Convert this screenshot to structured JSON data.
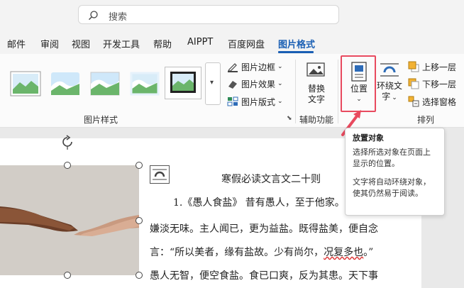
{
  "search": {
    "placeholder": "搜索"
  },
  "tabs": [
    {
      "label": "邮件"
    },
    {
      "label": "审阅"
    },
    {
      "label": "视图"
    },
    {
      "label": "开发工具"
    },
    {
      "label": "帮助"
    },
    {
      "label": "AIPPT"
    },
    {
      "label": "百度网盘"
    },
    {
      "label": "图片格式"
    }
  ],
  "ribbon": {
    "picture_styles": {
      "label": "图片样式",
      "border": "图片边框",
      "effects": "图片效果",
      "layout": "图片版式"
    },
    "accessibility": {
      "label": "辅助功能",
      "alt_text_line1": "替换",
      "alt_text_line2": "文字"
    },
    "arrange": {
      "label": "排列",
      "position": "位置",
      "wrap_line1": "环绕文",
      "wrap_line2": "字",
      "bring_forward": "上移一层",
      "send_backward": "下移一层",
      "selection_pane": "选择窗格"
    }
  },
  "tooltip": {
    "title": "放置对象",
    "desc": "选择所选对象在页面上显示的位置。",
    "note": "文字将自动环绕对象，使其仍然易于阅读。"
  },
  "document": {
    "heading": "寒假必读文言文二十则",
    "lines": [
      "1.《愚人食盐》 昔有愚人，至于他家。",
      "嫌淡无味。主人闻已，更为益盐。既得盐美，便自念",
      "言：“所以美者，缘有盐故。少有尚尔，",
      "况复多也",
      "。”",
      "愚人无智，便空食盐。食已口爽，反为其患。天下事"
    ]
  },
  "colors": {
    "accent": "#1a5fb4",
    "highlight": "#e84a5f"
  }
}
